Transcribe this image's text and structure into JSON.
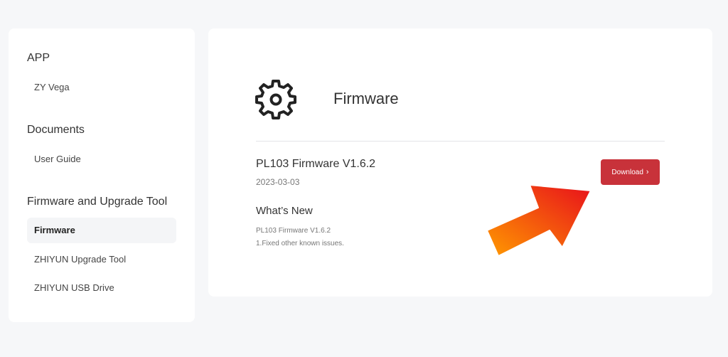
{
  "sidebar": {
    "sections": [
      {
        "title": "APP",
        "items": [
          "ZY Vega"
        ]
      },
      {
        "title": "Documents",
        "items": [
          "User Guide"
        ]
      },
      {
        "title": "Firmware and Upgrade Tool",
        "items": [
          "Firmware",
          "ZHIYUN Upgrade Tool",
          "ZHIYUN USB Drive"
        ]
      }
    ],
    "active_item": "Firmware"
  },
  "main": {
    "title": "Firmware",
    "icon": "gear-icon",
    "firmware": {
      "name": "PL103 Firmware V1.6.2",
      "date": "2023-03-03",
      "whats_new_label": "What’s New",
      "notes": [
        "PL103 Firmware V1.6.2",
        "1.Fixed other known issues."
      ],
      "download_label": "Download",
      "download_chevron": "›"
    }
  },
  "colors": {
    "download_button": "#c8323a",
    "arrow_start": "#ff9a00",
    "arrow_end": "#e8101b"
  }
}
